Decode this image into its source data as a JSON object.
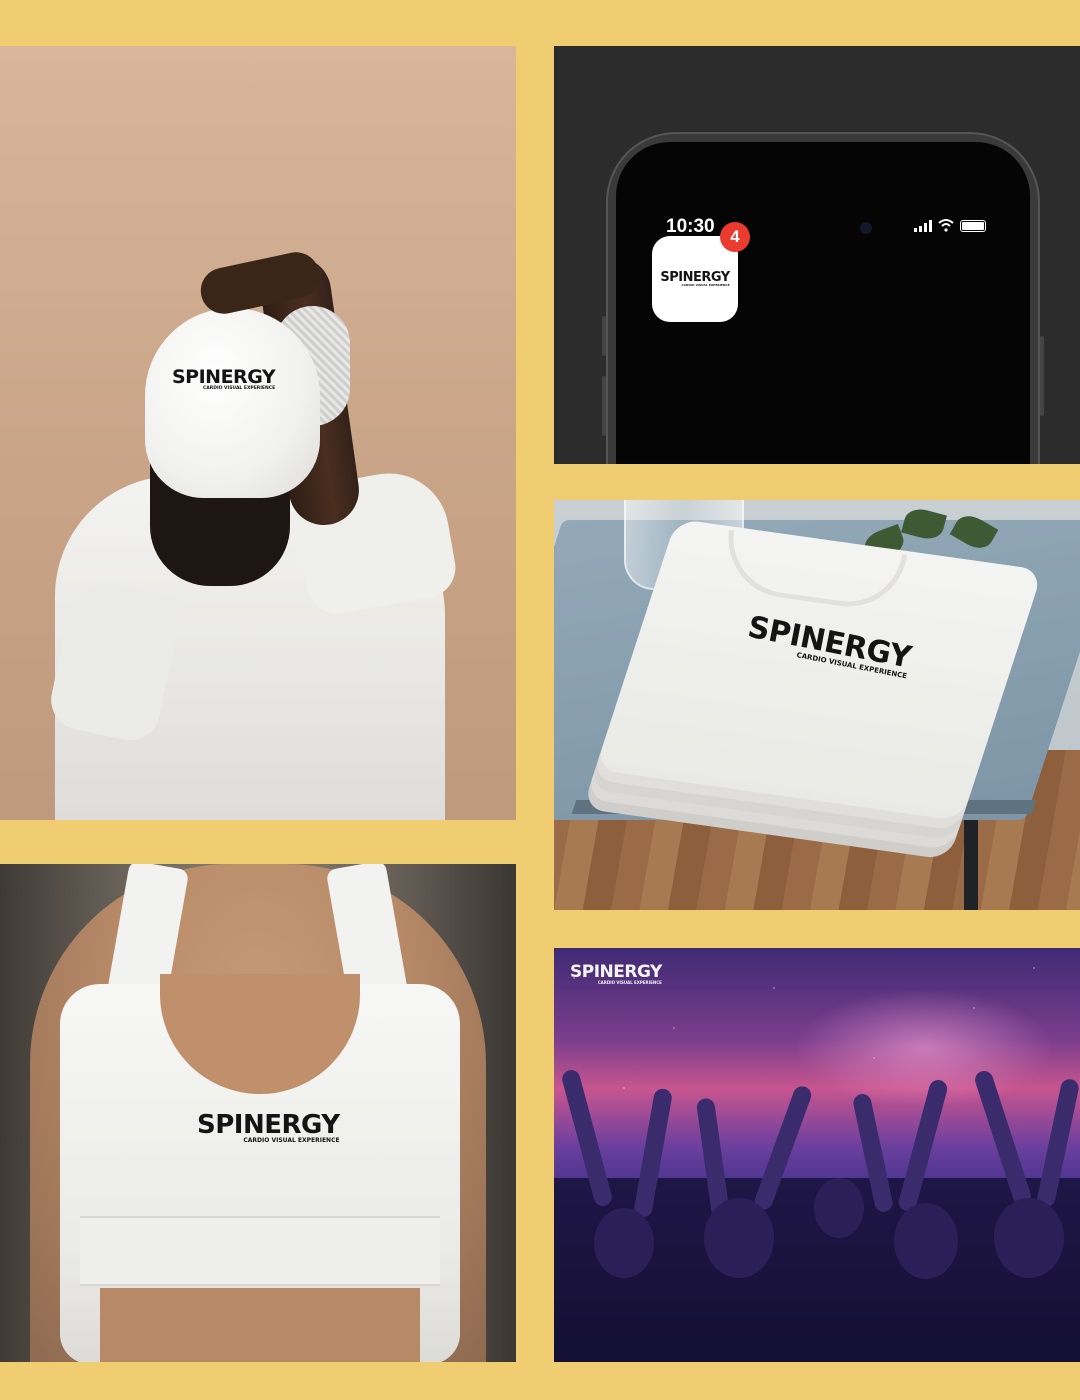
{
  "brand": {
    "wordmark": "SPINERGY",
    "tagline": "CARDIO VISUAL EXPERIENCE",
    "tm": "™",
    "accent_color": "#d72a2a",
    "background_color": "#f1cd72"
  },
  "phone": {
    "time": "10:30",
    "badge_count": "4",
    "status_icons": [
      "signal-icon",
      "wifi-icon",
      "battery-icon"
    ]
  }
}
